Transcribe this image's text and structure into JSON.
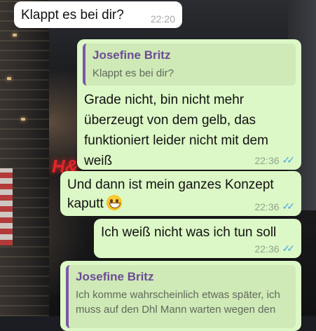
{
  "messages": [
    {
      "text": "Klappt es bei dir?",
      "time": "22:20"
    },
    {
      "quote_name": "Josefine Britz",
      "quote_text": "Klappt es bei dir?",
      "text": "Grade nicht, bin nicht mehr überzeugt von dem gelb, das funktioniert leider nicht mit dem weiß",
      "time": "22:36"
    },
    {
      "text": "Und dann ist mein ganzes Konzept kaputt",
      "time": "22:36"
    },
    {
      "text": "Ich weiß nicht was ich tun soll",
      "time": "22:36"
    },
    {
      "quote_name": "Josefine Britz",
      "quote_text": "Ich komme wahrscheinlich etwas später, ich muss auf den Dhl Mann warten wegen den"
    }
  ],
  "icons": {
    "read_receipt": "double-check-icon",
    "emoji": "grinning-face-icon"
  },
  "colors": {
    "outgoing_bubble": "#dcf8c6",
    "incoming_bubble": "#ffffff",
    "quote_accent": "#7b57a7",
    "read_ticks": "#4fa5e8"
  }
}
